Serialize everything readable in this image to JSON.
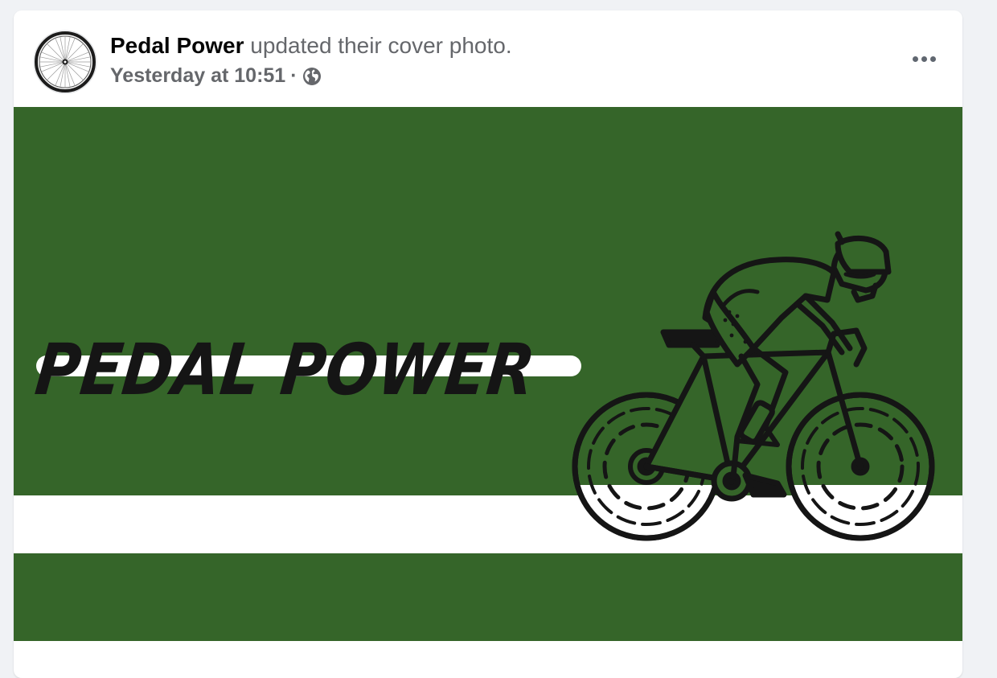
{
  "post": {
    "page_name": "Pedal Power",
    "action_text": "updated their cover photo.",
    "timestamp": "Yesterday at 10:51",
    "separator": "·",
    "privacy_icon": "globe-icon",
    "more_icon": "more-options-icon",
    "avatar_icon": "bicycle-wheel-icon"
  },
  "cover": {
    "brand_text": "PEDAL POWER",
    "illustration": "cyclist-icon",
    "colors": {
      "background_green": "#356529",
      "stripe_white": "#ffffff",
      "ink": "#151515"
    }
  }
}
